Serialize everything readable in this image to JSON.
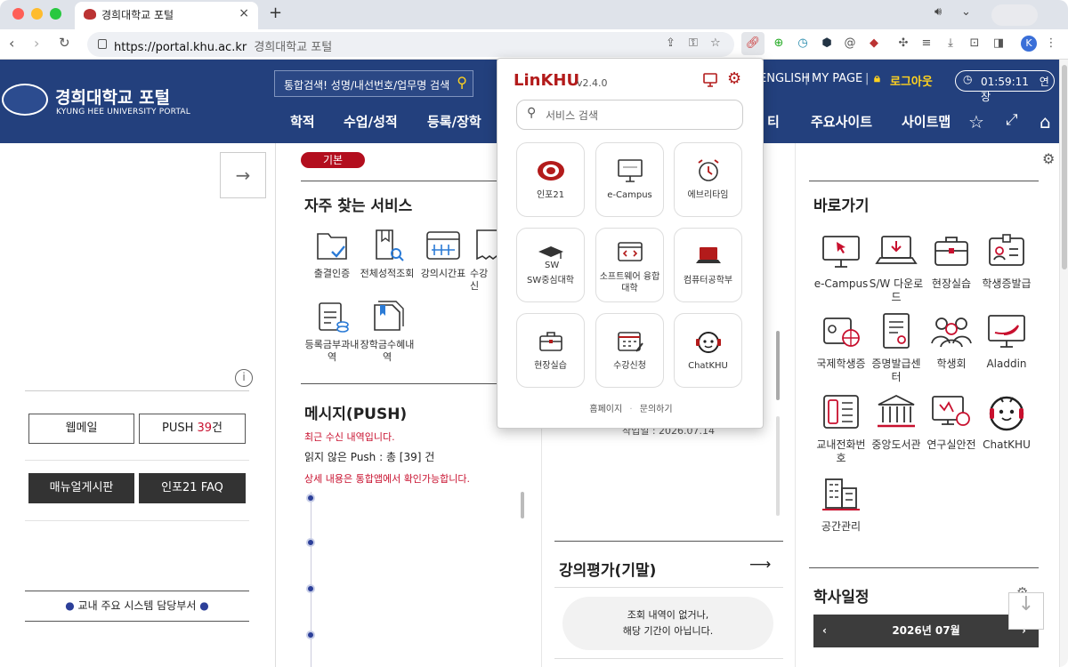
{
  "browser": {
    "tab_title": "경희대학교 포털",
    "url": "https://portal.khu.ac.kr",
    "url_title": "경희대학교 포털",
    "profile_initial": "K"
  },
  "header": {
    "logo_title": "경희대학교 포털",
    "logo_sub": "KYUNG HEE UNIVERSITY PORTAL",
    "search_placeholder": "통합검색! 성명/내선번호/업무명 검색",
    "english": "ENGLISH",
    "mypage": "MY PAGE",
    "logout": "로그아웃",
    "timer": "01:59:11",
    "extend": "연장",
    "menu": [
      "학적",
      "수업/성적",
      "등록/장학",
      "티",
      "주요사이트",
      "사이트맵"
    ]
  },
  "left": {
    "webmail": "웹메일",
    "push_label": "PUSH ",
    "push_count": "39",
    "push_unit": "건",
    "manual": "매뉴얼게시판",
    "faq": "인포21 FAQ",
    "dept": "교내 주요 시스템 담당부서"
  },
  "basic_pill": "기본",
  "frequent": {
    "title": "자주 찾는 서비스",
    "items": [
      "출결인증",
      "전체성적조회",
      "강의시간표",
      "수강신",
      "등록금부과내역",
      "장학금수혜내역"
    ]
  },
  "push": {
    "title": "메시지(PUSH)",
    "recent": "최근 수신 내역입니다.",
    "unread": "읽지 않은 Push : 총 [39] 건",
    "detail": "상세 내용은 통합앱에서 확인가능합니다."
  },
  "middle": {
    "partial": "작업일 : 2026.07.14",
    "eval_title": "강의평가(기말)",
    "nodata_1": "조회 내역이 없거나,",
    "nodata_2": "해당 기간이 아닙니다."
  },
  "shortcuts": {
    "title": "바로가기",
    "items": [
      "e-Campus",
      "S/W 다운로드",
      "현장실습",
      "학생증발급",
      "국제학생증",
      "증명발급센터",
      "학생회",
      "Aladdin",
      "교내전화번호",
      "중앙도서관",
      "연구실안전",
      "ChatKHU",
      "공간관리"
    ]
  },
  "calendar": {
    "title": "학사일정",
    "month": "2026년 07월"
  },
  "popup": {
    "title": "LinKHU",
    "version": "v2.4.0",
    "search_placeholder": "서비스 검색",
    "cards": [
      "인포21",
      "e-Campus",
      "에브리타임",
      "SW중심대학",
      "소프트웨어 융합대학",
      "컴퓨터공학부",
      "현장실습",
      "수강신청",
      "ChatKHU"
    ],
    "footer_home": "홈페이지",
    "footer_sep": "·",
    "footer_contact": "문의하기"
  },
  "colors": {
    "primary": "#23407d",
    "accent": "#b30e1e",
    "highlight": "#ffd21f"
  }
}
